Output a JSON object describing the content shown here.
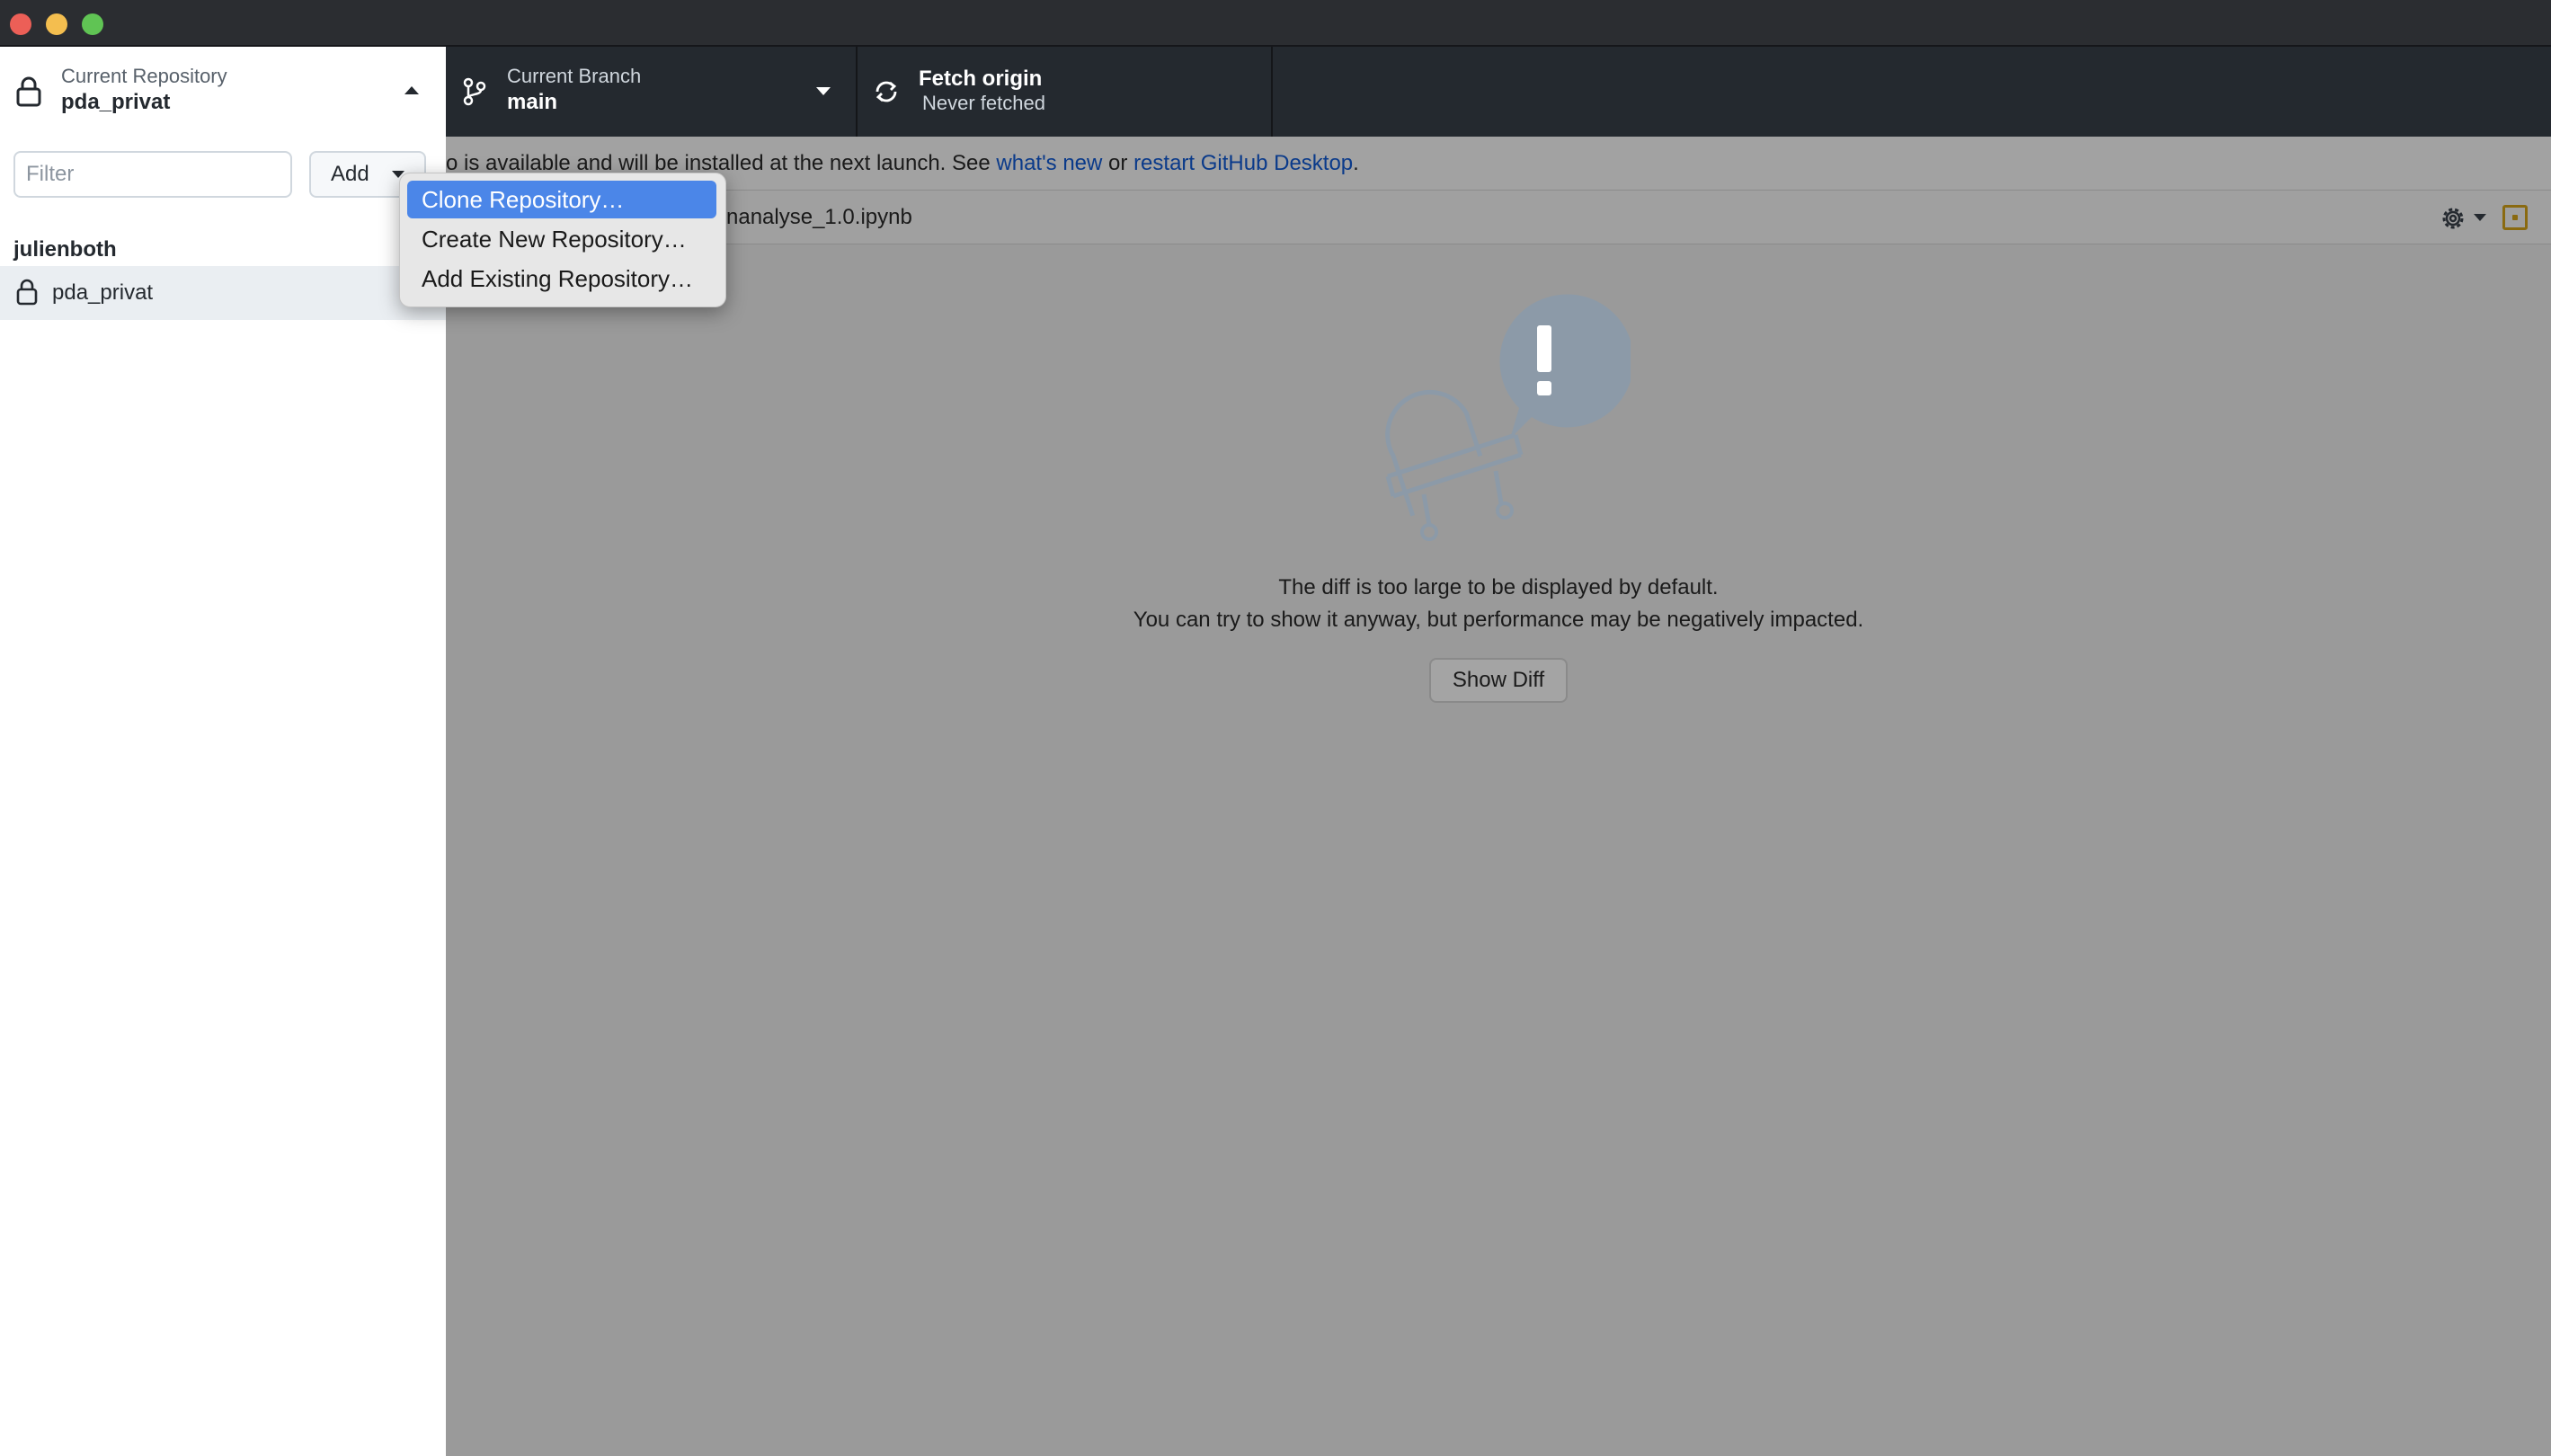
{
  "window": {
    "controls": [
      "close",
      "minimize",
      "maximize"
    ]
  },
  "toolbar": {
    "repository": {
      "label": "Current Repository",
      "value": "pda_privat",
      "icon": "lock-icon"
    },
    "branch": {
      "label": "Current Branch",
      "value": "main",
      "icon": "git-branch-icon"
    },
    "fetch": {
      "label": "Fetch origin",
      "sub": "Never fetched",
      "icon": "sync-icon"
    }
  },
  "sidebar": {
    "filter_placeholder": "Filter",
    "add_label": "Add",
    "group": "julienboth",
    "repos": [
      {
        "name": "pda_privat",
        "icon": "lock-icon"
      }
    ]
  },
  "menu": {
    "items": [
      {
        "label": "Clone Repository…",
        "active": true
      },
      {
        "label": "Create New Repository…",
        "active": false
      },
      {
        "label": "Add Existing Repository…",
        "active": false
      }
    ]
  },
  "banner": {
    "text_before": "o is available and will be installed at the next launch. See ",
    "link1": "what's new",
    "middle": " or ",
    "link2": "restart GitHub Desktop",
    "end": "."
  },
  "file": {
    "path": "nanalyse_1.0.ipynb"
  },
  "diff": {
    "message_line1": "The diff is too large to be displayed by default.",
    "message_line2": "You can try to show it anyway, but performance may be negatively impacted.",
    "button": "Show Diff"
  },
  "colors": {
    "toolbar_bg": "#24292f",
    "menu_highlight": "#4b86e8",
    "link": "#0a3a8a",
    "overlay_gray": "#9a9a9a"
  }
}
